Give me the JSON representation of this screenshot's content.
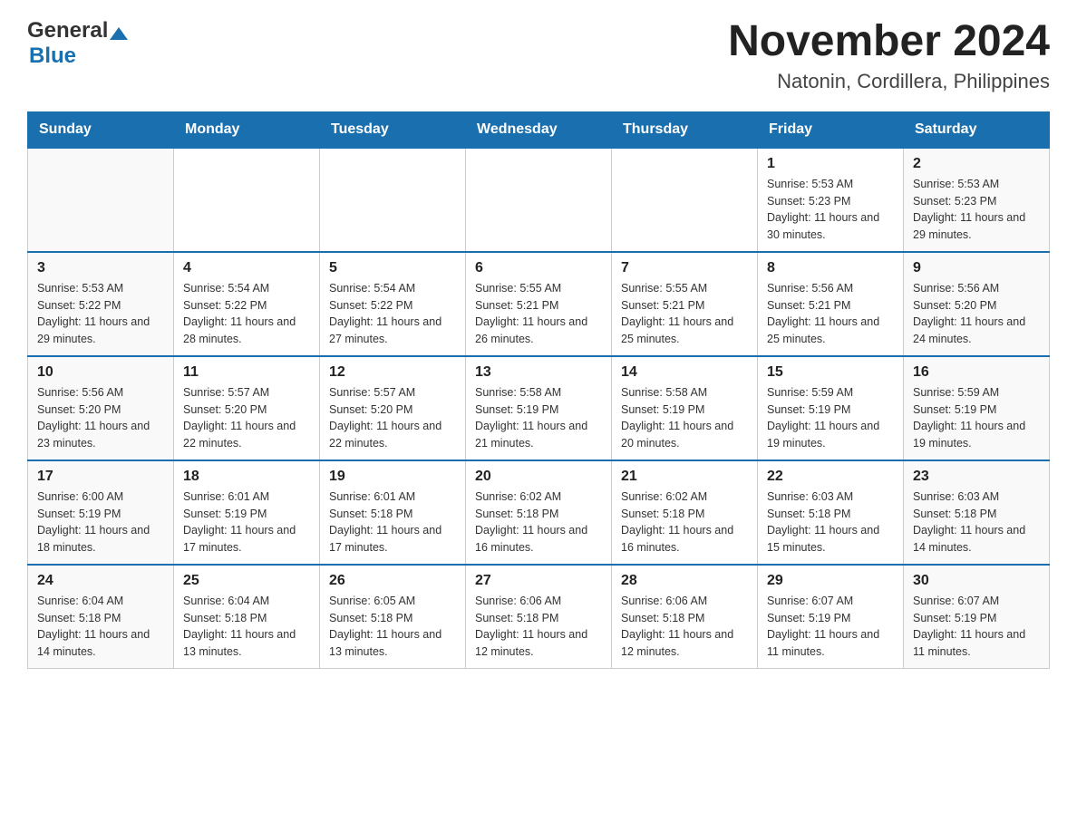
{
  "header": {
    "logo_general": "General",
    "logo_blue": "Blue",
    "month_title": "November 2024",
    "location": "Natonin, Cordillera, Philippines"
  },
  "weekdays": [
    "Sunday",
    "Monday",
    "Tuesday",
    "Wednesday",
    "Thursday",
    "Friday",
    "Saturday"
  ],
  "weeks": [
    [
      {
        "day": "",
        "info": ""
      },
      {
        "day": "",
        "info": ""
      },
      {
        "day": "",
        "info": ""
      },
      {
        "day": "",
        "info": ""
      },
      {
        "day": "",
        "info": ""
      },
      {
        "day": "1",
        "info": "Sunrise: 5:53 AM\nSunset: 5:23 PM\nDaylight: 11 hours and 30 minutes."
      },
      {
        "day": "2",
        "info": "Sunrise: 5:53 AM\nSunset: 5:23 PM\nDaylight: 11 hours and 29 minutes."
      }
    ],
    [
      {
        "day": "3",
        "info": "Sunrise: 5:53 AM\nSunset: 5:22 PM\nDaylight: 11 hours and 29 minutes."
      },
      {
        "day": "4",
        "info": "Sunrise: 5:54 AM\nSunset: 5:22 PM\nDaylight: 11 hours and 28 minutes."
      },
      {
        "day": "5",
        "info": "Sunrise: 5:54 AM\nSunset: 5:22 PM\nDaylight: 11 hours and 27 minutes."
      },
      {
        "day": "6",
        "info": "Sunrise: 5:55 AM\nSunset: 5:21 PM\nDaylight: 11 hours and 26 minutes."
      },
      {
        "day": "7",
        "info": "Sunrise: 5:55 AM\nSunset: 5:21 PM\nDaylight: 11 hours and 25 minutes."
      },
      {
        "day": "8",
        "info": "Sunrise: 5:56 AM\nSunset: 5:21 PM\nDaylight: 11 hours and 25 minutes."
      },
      {
        "day": "9",
        "info": "Sunrise: 5:56 AM\nSunset: 5:20 PM\nDaylight: 11 hours and 24 minutes."
      }
    ],
    [
      {
        "day": "10",
        "info": "Sunrise: 5:56 AM\nSunset: 5:20 PM\nDaylight: 11 hours and 23 minutes."
      },
      {
        "day": "11",
        "info": "Sunrise: 5:57 AM\nSunset: 5:20 PM\nDaylight: 11 hours and 22 minutes."
      },
      {
        "day": "12",
        "info": "Sunrise: 5:57 AM\nSunset: 5:20 PM\nDaylight: 11 hours and 22 minutes."
      },
      {
        "day": "13",
        "info": "Sunrise: 5:58 AM\nSunset: 5:19 PM\nDaylight: 11 hours and 21 minutes."
      },
      {
        "day": "14",
        "info": "Sunrise: 5:58 AM\nSunset: 5:19 PM\nDaylight: 11 hours and 20 minutes."
      },
      {
        "day": "15",
        "info": "Sunrise: 5:59 AM\nSunset: 5:19 PM\nDaylight: 11 hours and 19 minutes."
      },
      {
        "day": "16",
        "info": "Sunrise: 5:59 AM\nSunset: 5:19 PM\nDaylight: 11 hours and 19 minutes."
      }
    ],
    [
      {
        "day": "17",
        "info": "Sunrise: 6:00 AM\nSunset: 5:19 PM\nDaylight: 11 hours and 18 minutes."
      },
      {
        "day": "18",
        "info": "Sunrise: 6:01 AM\nSunset: 5:19 PM\nDaylight: 11 hours and 17 minutes."
      },
      {
        "day": "19",
        "info": "Sunrise: 6:01 AM\nSunset: 5:18 PM\nDaylight: 11 hours and 17 minutes."
      },
      {
        "day": "20",
        "info": "Sunrise: 6:02 AM\nSunset: 5:18 PM\nDaylight: 11 hours and 16 minutes."
      },
      {
        "day": "21",
        "info": "Sunrise: 6:02 AM\nSunset: 5:18 PM\nDaylight: 11 hours and 16 minutes."
      },
      {
        "day": "22",
        "info": "Sunrise: 6:03 AM\nSunset: 5:18 PM\nDaylight: 11 hours and 15 minutes."
      },
      {
        "day": "23",
        "info": "Sunrise: 6:03 AM\nSunset: 5:18 PM\nDaylight: 11 hours and 14 minutes."
      }
    ],
    [
      {
        "day": "24",
        "info": "Sunrise: 6:04 AM\nSunset: 5:18 PM\nDaylight: 11 hours and 14 minutes."
      },
      {
        "day": "25",
        "info": "Sunrise: 6:04 AM\nSunset: 5:18 PM\nDaylight: 11 hours and 13 minutes."
      },
      {
        "day": "26",
        "info": "Sunrise: 6:05 AM\nSunset: 5:18 PM\nDaylight: 11 hours and 13 minutes."
      },
      {
        "day": "27",
        "info": "Sunrise: 6:06 AM\nSunset: 5:18 PM\nDaylight: 11 hours and 12 minutes."
      },
      {
        "day": "28",
        "info": "Sunrise: 6:06 AM\nSunset: 5:18 PM\nDaylight: 11 hours and 12 minutes."
      },
      {
        "day": "29",
        "info": "Sunrise: 6:07 AM\nSunset: 5:19 PM\nDaylight: 11 hours and 11 minutes."
      },
      {
        "day": "30",
        "info": "Sunrise: 6:07 AM\nSunset: 5:19 PM\nDaylight: 11 hours and 11 minutes."
      }
    ]
  ]
}
